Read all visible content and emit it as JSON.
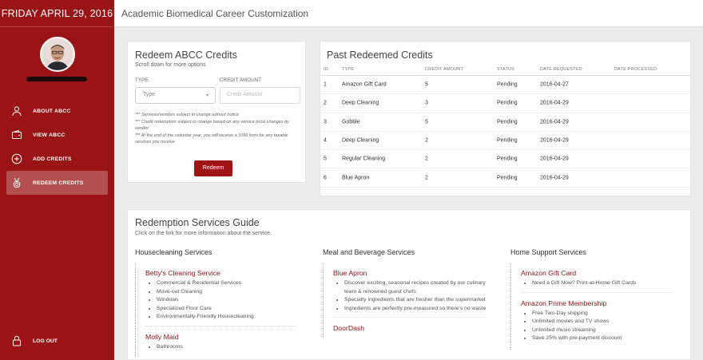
{
  "sidebar": {
    "date": "FRIDAY APRIL 29, 2016",
    "nav": [
      {
        "label": "ABOUT ABCC",
        "icon": "person-icon"
      },
      {
        "label": "VIEW ABCC",
        "icon": "wallet-icon"
      },
      {
        "label": "ADD CREDITS",
        "icon": "plus-circle-icon"
      },
      {
        "label": "REDEEM CREDITS",
        "icon": "medal-icon"
      }
    ],
    "active_index": 3,
    "logout_label": "LOG OUT",
    "logout_icon": "lock-icon"
  },
  "header": {
    "title": "Academic Biomedical Career Customization"
  },
  "redeem": {
    "title": "Redeem ABCC Credits",
    "subtitle": "Scroll down for more options",
    "type_label": "TYPE",
    "type_value": "Type",
    "amount_label": "CREDIT AMOUNT",
    "amount_placeholder": "Credit Amount",
    "notes": [
      "*** Services/vendors subject to change without notice",
      "*** Credit redemption subject to change based on any service price changes by vendor",
      "*** At the end of the calendar year, you will receive a 1099 form for any taxable services you receive"
    ],
    "button": "Redeem"
  },
  "past": {
    "title": "Past Redeemed Credits",
    "headers": [
      "ID",
      "TYPE",
      "CREDIT AMOUNT",
      "STATUS",
      "DATE REQUESTED",
      "DATE PROCESSED"
    ],
    "rows": [
      [
        "1",
        "Amazon Gift Card",
        "5",
        "Pending",
        "2016-04-27",
        ""
      ],
      [
        "2",
        "Deep Cleaning",
        "3",
        "Pending",
        "2016-04-29",
        ""
      ],
      [
        "3",
        "Gobble",
        "5",
        "Pending",
        "2016-04-29",
        ""
      ],
      [
        "4",
        "Deep Cleaning",
        "2",
        "Pending",
        "2016-04-29",
        ""
      ],
      [
        "5",
        "Regular Cleaning",
        "2",
        "Pending",
        "2016-04-29",
        ""
      ],
      [
        "6",
        "Blue Apron",
        "2",
        "Pending",
        "2016-04-29",
        ""
      ]
    ]
  },
  "guide": {
    "title": "Redemption Services Guide",
    "subtitle": "Click on the link for more information about the service.",
    "columns": [
      {
        "heading": "Housecleaning Services",
        "services": [
          {
            "name": "Betty's Cleaning Service",
            "items": [
              "Commercial & Residential Services",
              "Move-out Cleaning",
              "Windows",
              "Specialized Floor Care",
              "Environmentally-Friendly Housecleaning"
            ]
          },
          {
            "name": "Molly Maid",
            "items": [
              "Bathrooms"
            ]
          }
        ]
      },
      {
        "heading": "Meal and Beverage Services",
        "services": [
          {
            "name": "Blue Apron",
            "items": [
              "Discover exciting, seasonal recipes created by our culinary team & renowned guest chefs",
              "Specialty ingredients that are fresher than the supermarket",
              "Ingredients are perfectly pre-measured so there's no waste"
            ]
          },
          {
            "name": "DoorDash",
            "items": []
          }
        ]
      },
      {
        "heading": "Home Support Services",
        "services": [
          {
            "name": "Amazon Gift Card",
            "items": [
              "Need a Gift Now? Print-at-Home Gift Cards"
            ]
          },
          {
            "name": "Amazon Prime Membership",
            "items": [
              "Free Two-Day shipping",
              "Unlimited movies and TV shows",
              "Unlimited music streaming",
              "Save 25% with pre-payment discount"
            ]
          }
        ]
      }
    ]
  }
}
